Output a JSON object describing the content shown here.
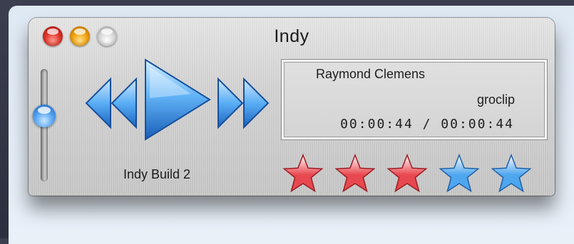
{
  "window": {
    "title": "Indy",
    "controls": [
      "close",
      "minimize",
      "zoom"
    ]
  },
  "volume": {
    "level": 0.6
  },
  "transport": {
    "rewind_icon": "rewind-icon",
    "play_icon": "play-icon",
    "fast_forward_icon": "fast-forward-icon"
  },
  "build_label": "Indy Build 2",
  "now_playing": {
    "artist": "Raymond Clemens",
    "track": "groclip",
    "time": "00:00:44 / 00:00:44"
  },
  "rating": {
    "value": 3,
    "max": 5,
    "filled_color": "#e8484f",
    "empty_color": "#4ea6ee"
  }
}
